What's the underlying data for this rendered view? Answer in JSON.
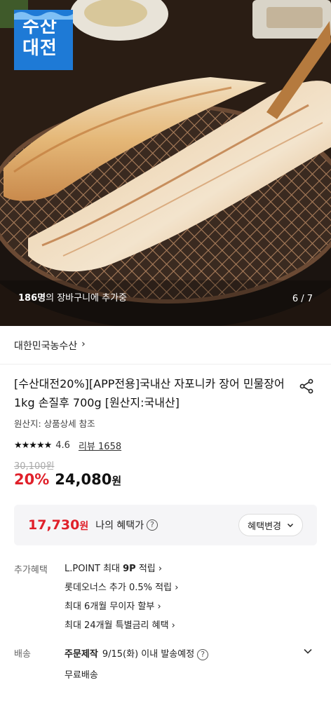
{
  "hero": {
    "badge_line1": "수산",
    "badge_line2": "대전",
    "cart_count": "186명",
    "cart_text": "의 장바구니에 추가중",
    "image_counter": "6 / 7"
  },
  "brand": {
    "name": "대한민국농수산",
    "chevron": "›"
  },
  "product": {
    "title": "[수산대전20%][APP전용]국내산 자포니카 장어 민물장어 1kg 손질후 700g [원산지:국내산]",
    "origin": "원산지: 상품상세 참조",
    "rating": "4.6",
    "stars": "★★★★★",
    "review": "리뷰 1658"
  },
  "price": {
    "original": "30,100원",
    "discount": "20%",
    "sale": "24,080",
    "won": "원"
  },
  "benefit": {
    "price": "17,730",
    "won": "원",
    "label": "나의 혜택가",
    "button": "혜택변경"
  },
  "extra": {
    "label": "추가혜택",
    "items": [
      {
        "prefix": "L.POINT 최대 ",
        "bold": "9P",
        "suffix": " 적립 ›"
      },
      {
        "prefix": "롯데오너스 추가 0.5% 적립 ›",
        "bold": "",
        "suffix": ""
      },
      {
        "prefix": "최대 6개월 무이자 할부 ›",
        "bold": "",
        "suffix": ""
      },
      {
        "prefix": "최대 24개월 특별금리 혜택 ›",
        "bold": "",
        "suffix": ""
      }
    ]
  },
  "shipping": {
    "label": "배송",
    "type": "주문제작",
    "date": "9/15(화) 이내 발송예정",
    "fee": "무료배송"
  },
  "icons": {
    "share": "share-icon",
    "help": "question-icon",
    "chevron_down": "chevron-down-icon"
  },
  "colors": {
    "accent_red": "#e0202a",
    "badge_blue": "#1e7ad6"
  }
}
